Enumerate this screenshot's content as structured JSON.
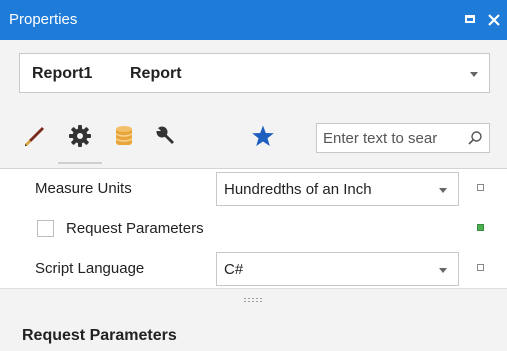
{
  "titlebar": {
    "title": "Properties"
  },
  "object_selector": {
    "name": "Report1",
    "type": "Report"
  },
  "toolbar": {
    "icons": [
      "pen-icon",
      "gear-icon",
      "database-icon",
      "wrench-icon",
      "star-icon"
    ],
    "active": "gear-icon",
    "search_placeholder": "Enter text to sear"
  },
  "properties": [
    {
      "label": "Measure Units",
      "value": "Hundredths of an Inch",
      "marker": "default"
    },
    {
      "label": "Request Parameters",
      "checked": false,
      "marker": "modified"
    },
    {
      "label": "Script Language",
      "value": "C#",
      "marker": "default"
    }
  ],
  "description": {
    "title": "Request Parameters"
  },
  "colors": {
    "titlebar": "#1f7bd8",
    "star": "#1f5fbf",
    "database": "#e8a53a",
    "modified_marker": "#4caf50"
  }
}
